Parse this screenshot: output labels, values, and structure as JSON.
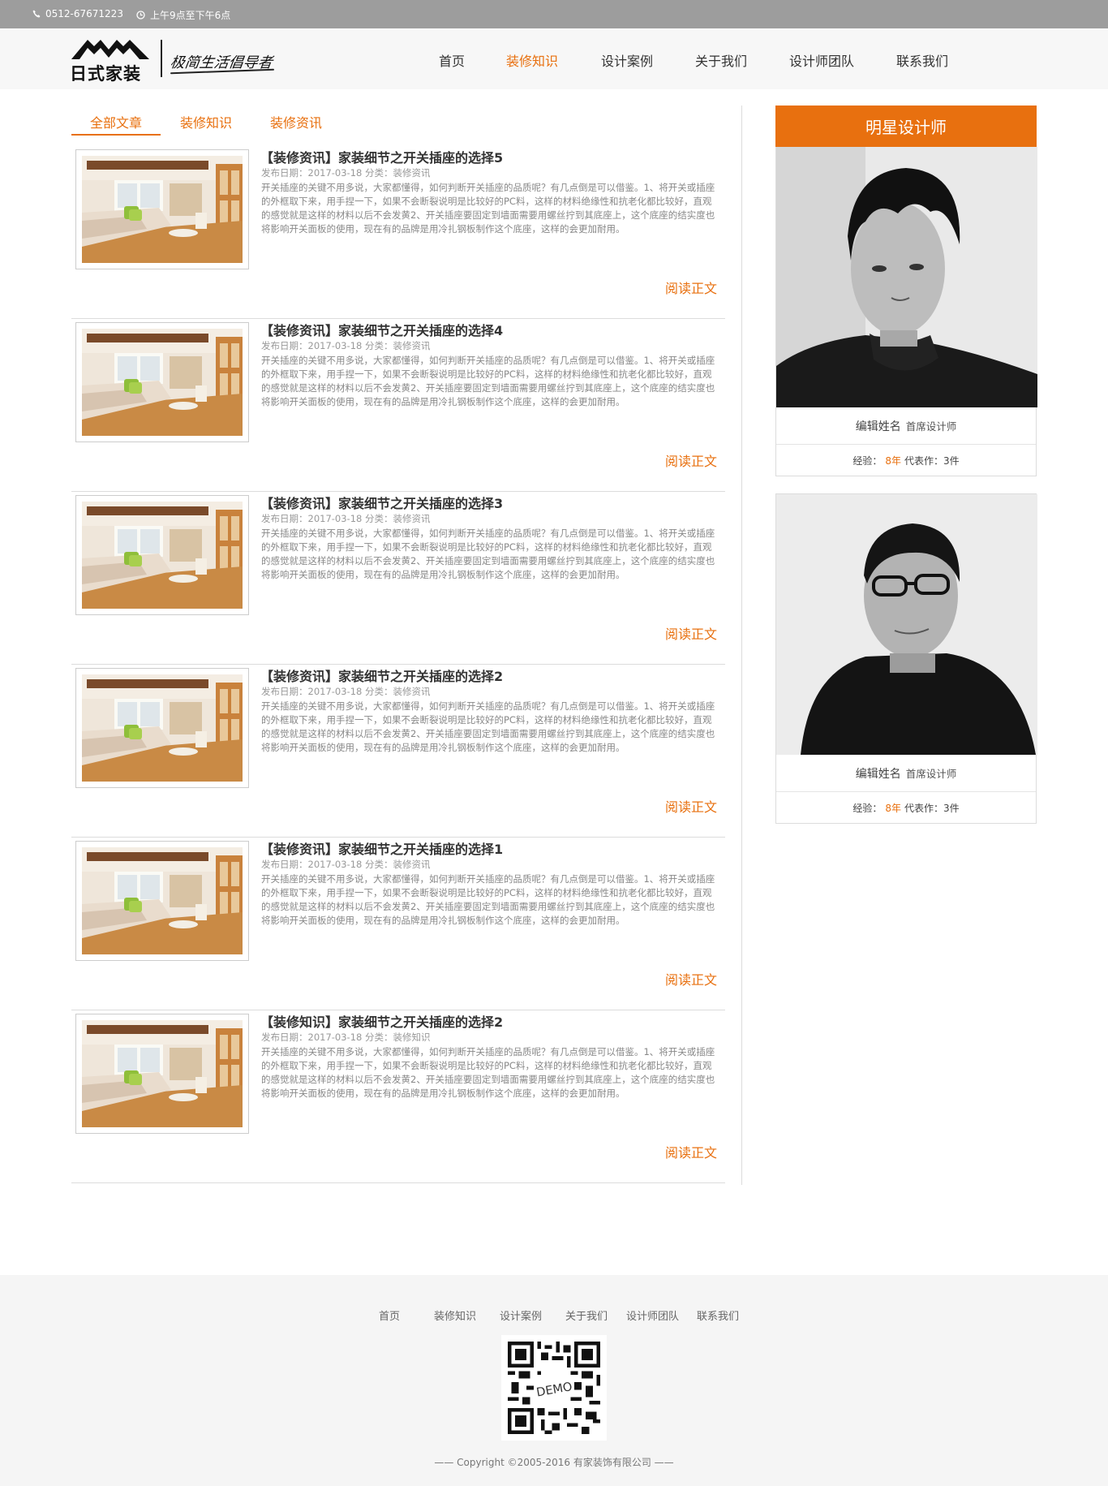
{
  "topbar": {
    "phone": "0512-67671223",
    "hours": "上午9点至下午6点",
    "phone_icon": "phone-icon",
    "clock_icon": "clock-icon"
  },
  "logo": {
    "name": "日式家装",
    "slogan": "极简生活倡导者"
  },
  "nav": {
    "items": [
      {
        "label": "首页",
        "active": false
      },
      {
        "label": "装修知识",
        "active": true
      },
      {
        "label": "设计案例",
        "active": false
      },
      {
        "label": "关于我们",
        "active": false
      },
      {
        "label": "设计师团队",
        "active": false
      },
      {
        "label": "联系我们",
        "active": false
      }
    ]
  },
  "tabs": {
    "items": [
      {
        "label": "全部文章",
        "active": true
      },
      {
        "label": "装修知识",
        "active": false
      },
      {
        "label": "装修资讯",
        "active": false
      }
    ]
  },
  "articles": [
    {
      "title": "【装修资讯】家装细节之开关插座的选择5",
      "meta": "发布日期：2017-03-18 分类：装修资讯",
      "excerpt": "开关插座的关键不用多说，大家都懂得，如何判断开关插座的品质呢？有几点倒是可以借鉴。1、将开关或插座的外框取下来，用手捏一下，如果不会断裂说明是比较好的PC料，这样的材料绝缘性和抗老化都比较好，直观的感觉就是这样的材料以后不会发黄2、开关插座要固定到墙面需要用螺丝拧到其底座上，这个底座的结实度也将影响开关面板的使用，现在有的品牌是用冷扎钢板制作这个底座，这样的会更加耐用。",
      "more": "阅读正文"
    },
    {
      "title": "【装修资讯】家装细节之开关插座的选择4",
      "meta": "发布日期：2017-03-18 分类：装修资讯",
      "excerpt": "开关插座的关键不用多说，大家都懂得，如何判断开关插座的品质呢？有几点倒是可以借鉴。1、将开关或插座的外框取下来，用手捏一下，如果不会断裂说明是比较好的PC料，这样的材料绝缘性和抗老化都比较好，直观的感觉就是这样的材料以后不会发黄2、开关插座要固定到墙面需要用螺丝拧到其底座上，这个底座的结实度也将影响开关面板的使用，现在有的品牌是用冷扎钢板制作这个底座，这样的会更加耐用。",
      "more": "阅读正文"
    },
    {
      "title": "【装修资讯】家装细节之开关插座的选择3",
      "meta": "发布日期：2017-03-18 分类：装修资讯",
      "excerpt": "开关插座的关键不用多说，大家都懂得，如何判断开关插座的品质呢？有几点倒是可以借鉴。1、将开关或插座的外框取下来，用手捏一下，如果不会断裂说明是比较好的PC料，这样的材料绝缘性和抗老化都比较好，直观的感觉就是这样的材料以后不会发黄2、开关插座要固定到墙面需要用螺丝拧到其底座上，这个底座的结实度也将影响开关面板的使用，现在有的品牌是用冷扎钢板制作这个底座，这样的会更加耐用。",
      "more": "阅读正文"
    },
    {
      "title": "【装修资讯】家装细节之开关插座的选择2",
      "meta": "发布日期：2017-03-18 分类：装修资讯",
      "excerpt": "开关插座的关键不用多说，大家都懂得，如何判断开关插座的品质呢？有几点倒是可以借鉴。1、将开关或插座的外框取下来，用手捏一下，如果不会断裂说明是比较好的PC料，这样的材料绝缘性和抗老化都比较好，直观的感觉就是这样的材料以后不会发黄2、开关插座要固定到墙面需要用螺丝拧到其底座上，这个底座的结实度也将影响开关面板的使用，现在有的品牌是用冷扎钢板制作这个底座，这样的会更加耐用。",
      "more": "阅读正文"
    },
    {
      "title": "【装修资讯】家装细节之开关插座的选择1",
      "meta": "发布日期：2017-03-18 分类：装修资讯",
      "excerpt": "开关插座的关键不用多说，大家都懂得，如何判断开关插座的品质呢？有几点倒是可以借鉴。1、将开关或插座的外框取下来，用手捏一下，如果不会断裂说明是比较好的PC料，这样的材料绝缘性和抗老化都比较好，直观的感觉就是这样的材料以后不会发黄2、开关插座要固定到墙面需要用螺丝拧到其底座上，这个底座的结实度也将影响开关面板的使用，现在有的品牌是用冷扎钢板制作这个底座，这样的会更加耐用。",
      "more": "阅读正文"
    },
    {
      "title": "【装修知识】家装细节之开关插座的选择2",
      "meta": "发布日期：2017-03-18 分类：装修知识",
      "excerpt": "开关插座的关键不用多说，大家都懂得，如何判断开关插座的品质呢？有几点倒是可以借鉴。1、将开关或插座的外框取下来，用手捏一下，如果不会断裂说明是比较好的PC料，这样的材料绝缘性和抗老化都比较好，直观的感觉就是这样的材料以后不会发黄2、开关插座要固定到墙面需要用螺丝拧到其底座上，这个底座的结实度也将影响开关面板的使用，现在有的品牌是用冷扎钢板制作这个底座，这样的会更加耐用。",
      "more": "阅读正文"
    }
  ],
  "sidebar": {
    "title": "明星设计师",
    "designers": [
      {
        "name": "编辑姓名",
        "role": "首席设计师",
        "exp_label": "经验：",
        "years": "8年",
        "works": "代表作：3件"
      },
      {
        "name": "编辑姓名",
        "role": "首席设计师",
        "exp_label": "经验：",
        "years": "8年",
        "works": "代表作：3件"
      }
    ]
  },
  "footer": {
    "links": [
      "首页",
      "装修知识",
      "设计案例",
      "关于我们",
      "设计师团队",
      "联系我们"
    ],
    "qr_label": "DEMO",
    "copyright": "—— Copyright ©2005-2016 有家装饰有限公司 ——"
  },
  "colors": {
    "accent": "#e8700f",
    "topbar": "#9d9d9d"
  }
}
